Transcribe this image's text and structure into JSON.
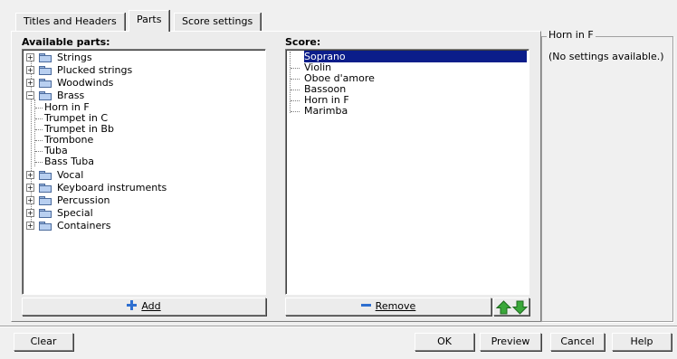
{
  "tabs": [
    {
      "label": "Titles and Headers",
      "active": false
    },
    {
      "label": "Parts",
      "active": true
    },
    {
      "label": "Score settings",
      "active": false
    }
  ],
  "available": {
    "label": "Available parts:",
    "groups": [
      {
        "label": "Strings",
        "expanded": false
      },
      {
        "label": "Plucked strings",
        "expanded": false
      },
      {
        "label": "Woodwinds",
        "expanded": false
      },
      {
        "label": "Brass",
        "expanded": true,
        "children": [
          "Horn in F",
          "Trumpet in C",
          "Trumpet in Bb",
          "Trombone",
          "Tuba",
          "Bass Tuba"
        ]
      },
      {
        "label": "Vocal",
        "expanded": false
      },
      {
        "label": "Keyboard instruments",
        "expanded": false
      },
      {
        "label": "Percussion",
        "expanded": false
      },
      {
        "label": "Special",
        "expanded": false
      },
      {
        "label": "Containers",
        "expanded": false
      }
    ],
    "add_label": "Add"
  },
  "score": {
    "label": "Score:",
    "items": [
      "Soprano",
      "Violin",
      "Oboe d'amore",
      "Bassoon",
      "Horn in F",
      "Marimba"
    ],
    "selected_index": 0,
    "remove_label": "Remove"
  },
  "settings": {
    "title": "Horn in F",
    "message": "(No settings available.)"
  },
  "footer": {
    "clear": "Clear",
    "ok": "OK",
    "preview": "Preview",
    "cancel": "Cancel",
    "help": "Help"
  },
  "colors": {
    "selection": "#0b1d8a",
    "arrow_green": "#3aa83a",
    "add_blue": "#2f6fd0"
  }
}
